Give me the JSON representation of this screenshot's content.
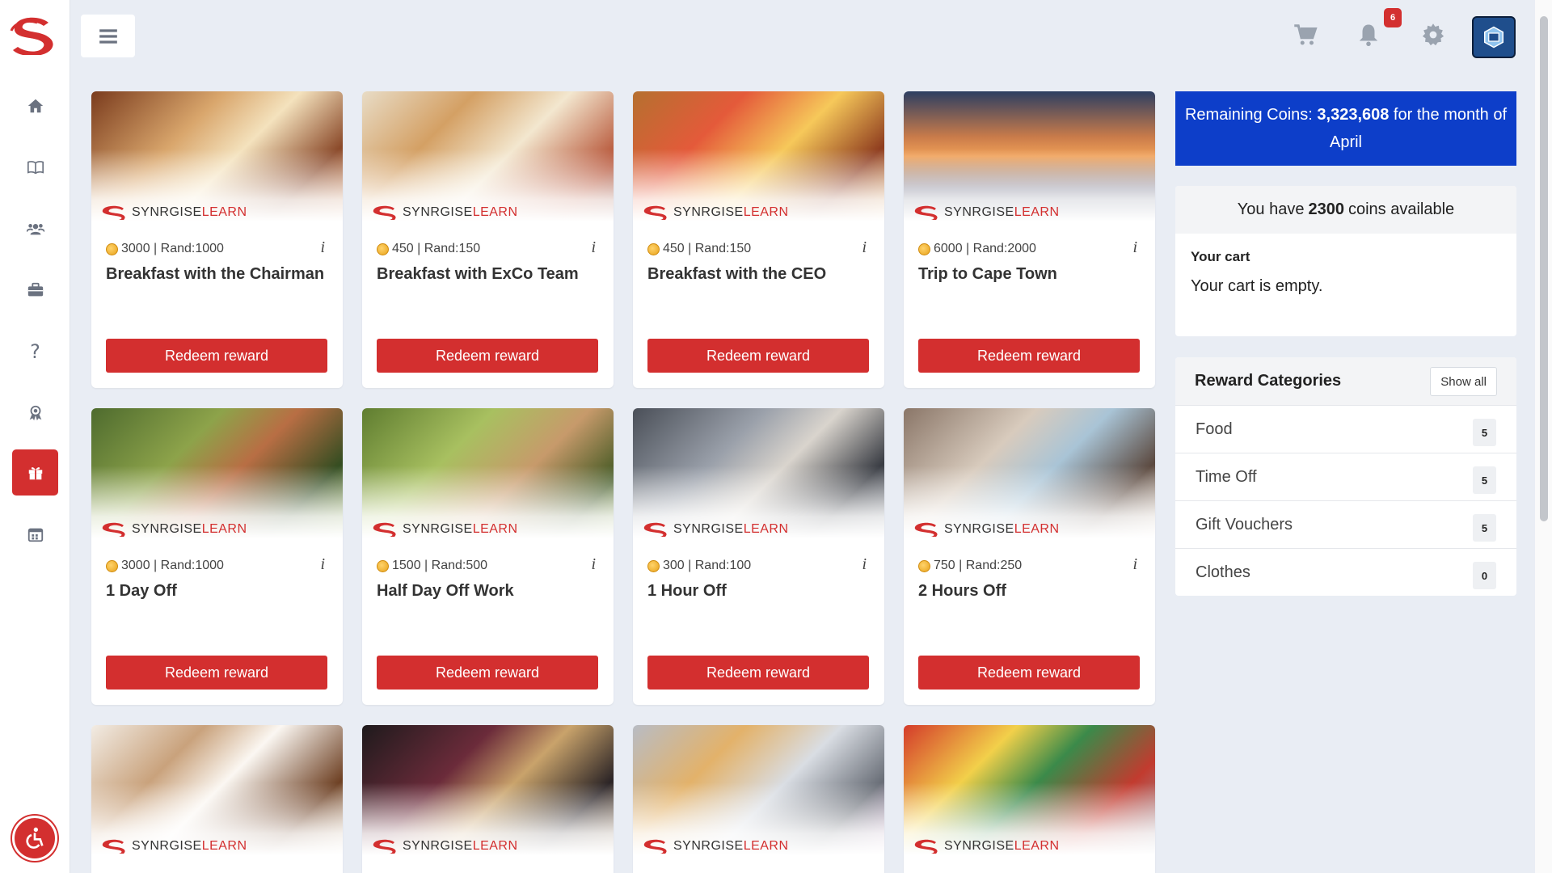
{
  "sidebar": {
    "items": [
      {
        "name": "home"
      },
      {
        "name": "book"
      },
      {
        "name": "users"
      },
      {
        "name": "briefcase"
      },
      {
        "name": "help",
        "label": "?"
      },
      {
        "name": "award"
      },
      {
        "name": "gift",
        "active": true
      },
      {
        "name": "calendar"
      }
    ]
  },
  "topbar": {
    "notifications_count": "6"
  },
  "brand": {
    "prefix": "SYNRGISE",
    "suffix": "LEARN"
  },
  "cards": [
    {
      "price": "3000 | Rand:1000",
      "title": "Breakfast with the Chairman",
      "button": "Redeem reward"
    },
    {
      "price": "450 | Rand:150",
      "title": "Breakfast with ExCo Team",
      "button": "Redeem reward"
    },
    {
      "price": "450 | Rand:150",
      "title": "Breakfast with the CEO",
      "button": "Redeem reward"
    },
    {
      "price": "6000 | Rand:2000",
      "title": "Trip to Cape Town",
      "button": "Redeem reward"
    },
    {
      "price": "3000 | Rand:1000",
      "title": "1 Day Off",
      "button": "Redeem reward"
    },
    {
      "price": "1500 | Rand:500",
      "title": "Half Day Off Work",
      "button": "Redeem reward"
    },
    {
      "price": "300 | Rand:100",
      "title": "1 Hour Off",
      "button": "Redeem reward"
    },
    {
      "price": "750 | Rand:250",
      "title": "2 Hours Off",
      "button": "Redeem reward"
    },
    {
      "price": "",
      "title": "",
      "button": ""
    },
    {
      "price": "",
      "title": "",
      "button": ""
    },
    {
      "price": "",
      "title": "",
      "button": ""
    },
    {
      "price": "",
      "title": "",
      "button": ""
    }
  ],
  "coins_banner": {
    "prefix": "Remaining Coins: ",
    "amount": "3,323,608",
    "suffix": " for the month of April"
  },
  "cart": {
    "available_prefix": "You have",
    "available_amount": "2300",
    "available_suffix": "coins available",
    "label": "Your cart",
    "empty_text": "Your cart is empty."
  },
  "categories": {
    "title": "Reward Categories",
    "show_all": "Show all",
    "items": [
      {
        "name": "Food",
        "count": "5"
      },
      {
        "name": "Time Off",
        "count": "5"
      },
      {
        "name": "Gift Vouchers",
        "count": "5"
      },
      {
        "name": "Clothes",
        "count": "0"
      }
    ]
  },
  "colors": {
    "accent": "#d32f2f",
    "banner": "#0d3ec9",
    "background": "#e9edf4"
  }
}
